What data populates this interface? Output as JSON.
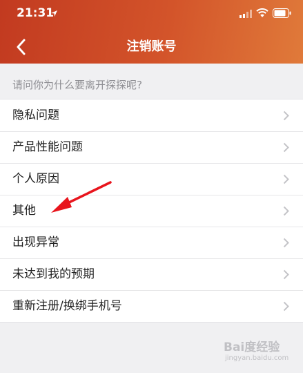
{
  "status_bar": {
    "time": "21:31"
  },
  "nav": {
    "title": "注销账号"
  },
  "prompt": "请问你为什么要离开探探呢?",
  "reasons": [
    {
      "label": "隐私问题"
    },
    {
      "label": "产品性能问题"
    },
    {
      "label": "个人原因"
    },
    {
      "label": "其他"
    },
    {
      "label": "出现异常"
    },
    {
      "label": "未达到我的预期"
    },
    {
      "label": "重新注册/换绑手机号"
    }
  ],
  "watermark": {
    "brand": "Bai度经验",
    "url": "jingyan.baidu.com"
  },
  "colors": {
    "header_start": "#c23a20",
    "header_end": "#e07a3a",
    "annotation_arrow": "#e8141c",
    "background": "#f0f0f2"
  },
  "icons": [
    "location-arrow-icon",
    "signal-icon",
    "wifi-icon",
    "battery-icon",
    "back-chevron-icon",
    "chevron-right-icon"
  ]
}
